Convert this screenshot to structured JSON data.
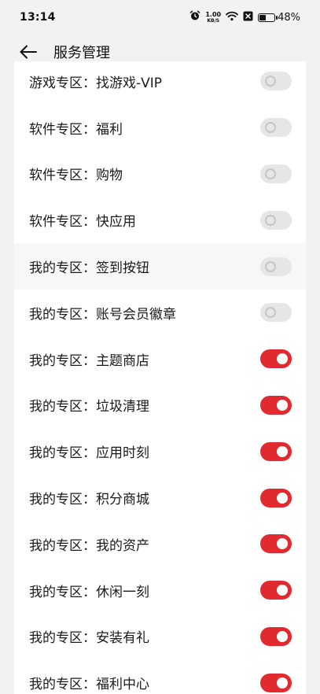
{
  "status_bar": {
    "time": "13:14",
    "net_speed_value": "1.00",
    "net_speed_unit": "KB/S",
    "battery_percent": "48%",
    "battery_level": 0.48,
    "icons": [
      "alarm-icon",
      "wifi-icon",
      "sim-off-icon",
      "battery-icon"
    ]
  },
  "header": {
    "back_icon": "back-arrow-icon",
    "title": "服务管理"
  },
  "colors": {
    "toggle_on": "#e02a2f",
    "toggle_off": "#e6e6e6",
    "background": "#f2f2f2",
    "card": "#ffffff"
  },
  "items": [
    {
      "label": "游戏专区：找游戏-VIP",
      "enabled": false
    },
    {
      "label": "软件专区：福利",
      "enabled": false
    },
    {
      "label": "软件专区：购物",
      "enabled": false
    },
    {
      "label": "软件专区：快应用",
      "enabled": false
    },
    {
      "label": "我的专区：签到按钮",
      "enabled": false
    },
    {
      "label": "我的专区：账号会员徽章",
      "enabled": false
    },
    {
      "label": "我的专区：主题商店",
      "enabled": true
    },
    {
      "label": "我的专区：垃圾清理",
      "enabled": true
    },
    {
      "label": "我的专区：应用时刻",
      "enabled": true
    },
    {
      "label": "我的专区：积分商城",
      "enabled": true
    },
    {
      "label": "我的专区：我的资产",
      "enabled": true
    },
    {
      "label": "我的专区：休闲一刻",
      "enabled": true
    },
    {
      "label": "我的专区：安装有礼",
      "enabled": true
    },
    {
      "label": "我的专区：福利中心",
      "enabled": true
    }
  ]
}
